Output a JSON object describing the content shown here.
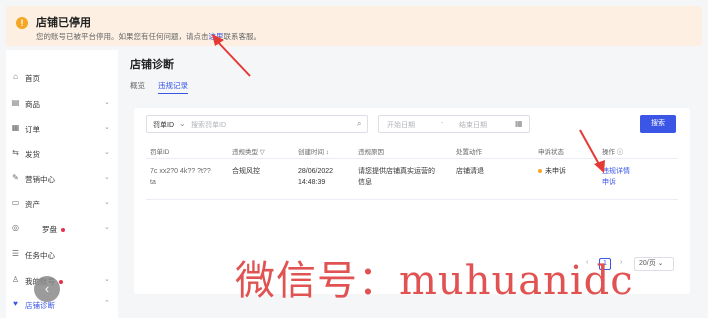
{
  "banner": {
    "title": "店铺已停用",
    "desc_prefix": "您的账号已被平台停用。如果您有任何问题，请点击",
    "link": "这里",
    "desc_suffix": "联系客服。"
  },
  "sidebar": {
    "items": [
      {
        "label": "首页",
        "icon": "home-icon",
        "glyph": "⌂"
      },
      {
        "label": "商品",
        "icon": "box-icon",
        "glyph": "▤",
        "chevron": "⌄"
      },
      {
        "label": "订单",
        "icon": "order-icon",
        "glyph": "▦",
        "chevron": "⌄"
      },
      {
        "label": "发货",
        "icon": "truck-icon",
        "glyph": "⇆",
        "chevron": "⌄"
      },
      {
        "label": "营销中心",
        "icon": "marketing-icon",
        "glyph": "✎",
        "chevron": "⌄"
      },
      {
        "label": "资产",
        "icon": "asset-icon",
        "glyph": "▭",
        "chevron": "⌄"
      },
      {
        "label": "罗盘",
        "icon": "compass-icon",
        "glyph": "◎",
        "chevron": "⌄",
        "dot": true
      },
      {
        "label": "任务中心",
        "icon": "task-icon",
        "glyph": "☰"
      },
      {
        "label": "我的账号",
        "icon": "user-icon",
        "glyph": "♙",
        "chevron": "⌄",
        "dot": true
      },
      {
        "label": "店铺诊断",
        "icon": "diagnosis-icon",
        "glyph": "♥",
        "chevron": "⌃",
        "active": true
      }
    ],
    "collapse_glyph": "‹"
  },
  "main": {
    "title": "店铺诊断",
    "tabs": [
      {
        "label": "概览",
        "active": false
      },
      {
        "label": "违规记录",
        "active": true
      }
    ]
  },
  "filters": {
    "select_label": "罚单ID",
    "select_placeholder": "搜索罚单ID",
    "start_placeholder": "开始日期",
    "end_placeholder": "结束日期",
    "separator": "-",
    "search_button": "搜索"
  },
  "table": {
    "headers": [
      "罚单ID",
      "违规类型 ▽",
      "创建时间 ↕",
      "违规原因",
      "处置动作",
      "申诉状态",
      "操作 ⓘ"
    ],
    "rows": [
      {
        "id_line1": "7c xx2?0 4k?? ?t??",
        "id_line2": "ta",
        "type": "合规风控",
        "time_line1": "28/06/2022",
        "time_line2": "14:48:39",
        "reason_line1": "请您提供店铺真实运营的",
        "reason_line2": "信息",
        "action": "店铺清退",
        "status": "未申诉",
        "op_line1": "违规详情",
        "op_line2": "申诉"
      }
    ]
  },
  "pagination": {
    "prev": "‹",
    "page": "1",
    "next": "›",
    "page_size": "20/页 ⌄"
  },
  "watermark": "微信号：muhuanidc",
  "colors": {
    "accent": "#3b55e6",
    "warning": "#f5a623",
    "annotation": "#e53935"
  }
}
